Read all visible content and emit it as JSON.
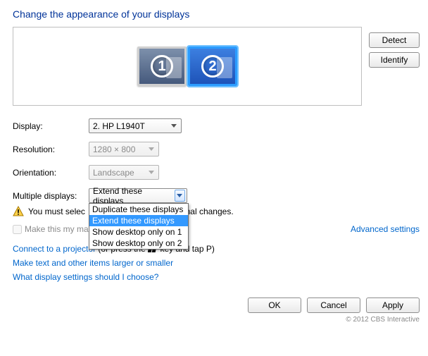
{
  "title": "Change the appearance of your displays",
  "buttons": {
    "detect": "Detect",
    "identify": "Identify",
    "ok": "OK",
    "cancel": "Cancel",
    "apply": "Apply"
  },
  "monitors": [
    {
      "number": "1",
      "selected": false
    },
    {
      "number": "2",
      "selected": true
    }
  ],
  "labels": {
    "display": "Display:",
    "resolution": "Resolution:",
    "orientation": "Orientation:",
    "multiple": "Multiple displays:"
  },
  "values": {
    "display": "2. HP L1940T",
    "resolution": "1280 × 800",
    "orientation": "Landscape",
    "multiple_selected": "Extend these displays"
  },
  "multiple_options": [
    "Duplicate these displays",
    "Extend these displays",
    "Show desktop only on 1",
    "Show desktop only on 2"
  ],
  "warning": "You must select Apply before making additional changes.",
  "warning_visible_prefix": "You must selec",
  "warning_visible_suffix": "onal changes.",
  "maincheck": "Make this my ma",
  "advanced": "Advanced settings",
  "links": {
    "projector_link": "Connect to a projector",
    "projector_rest_a": " (or press the ",
    "projector_rest_b": " key and tap P)",
    "textsize": "Make text and other items larger or smaller",
    "which": "What display settings should I choose?"
  },
  "copyright": "© 2012 CBS Interactive"
}
